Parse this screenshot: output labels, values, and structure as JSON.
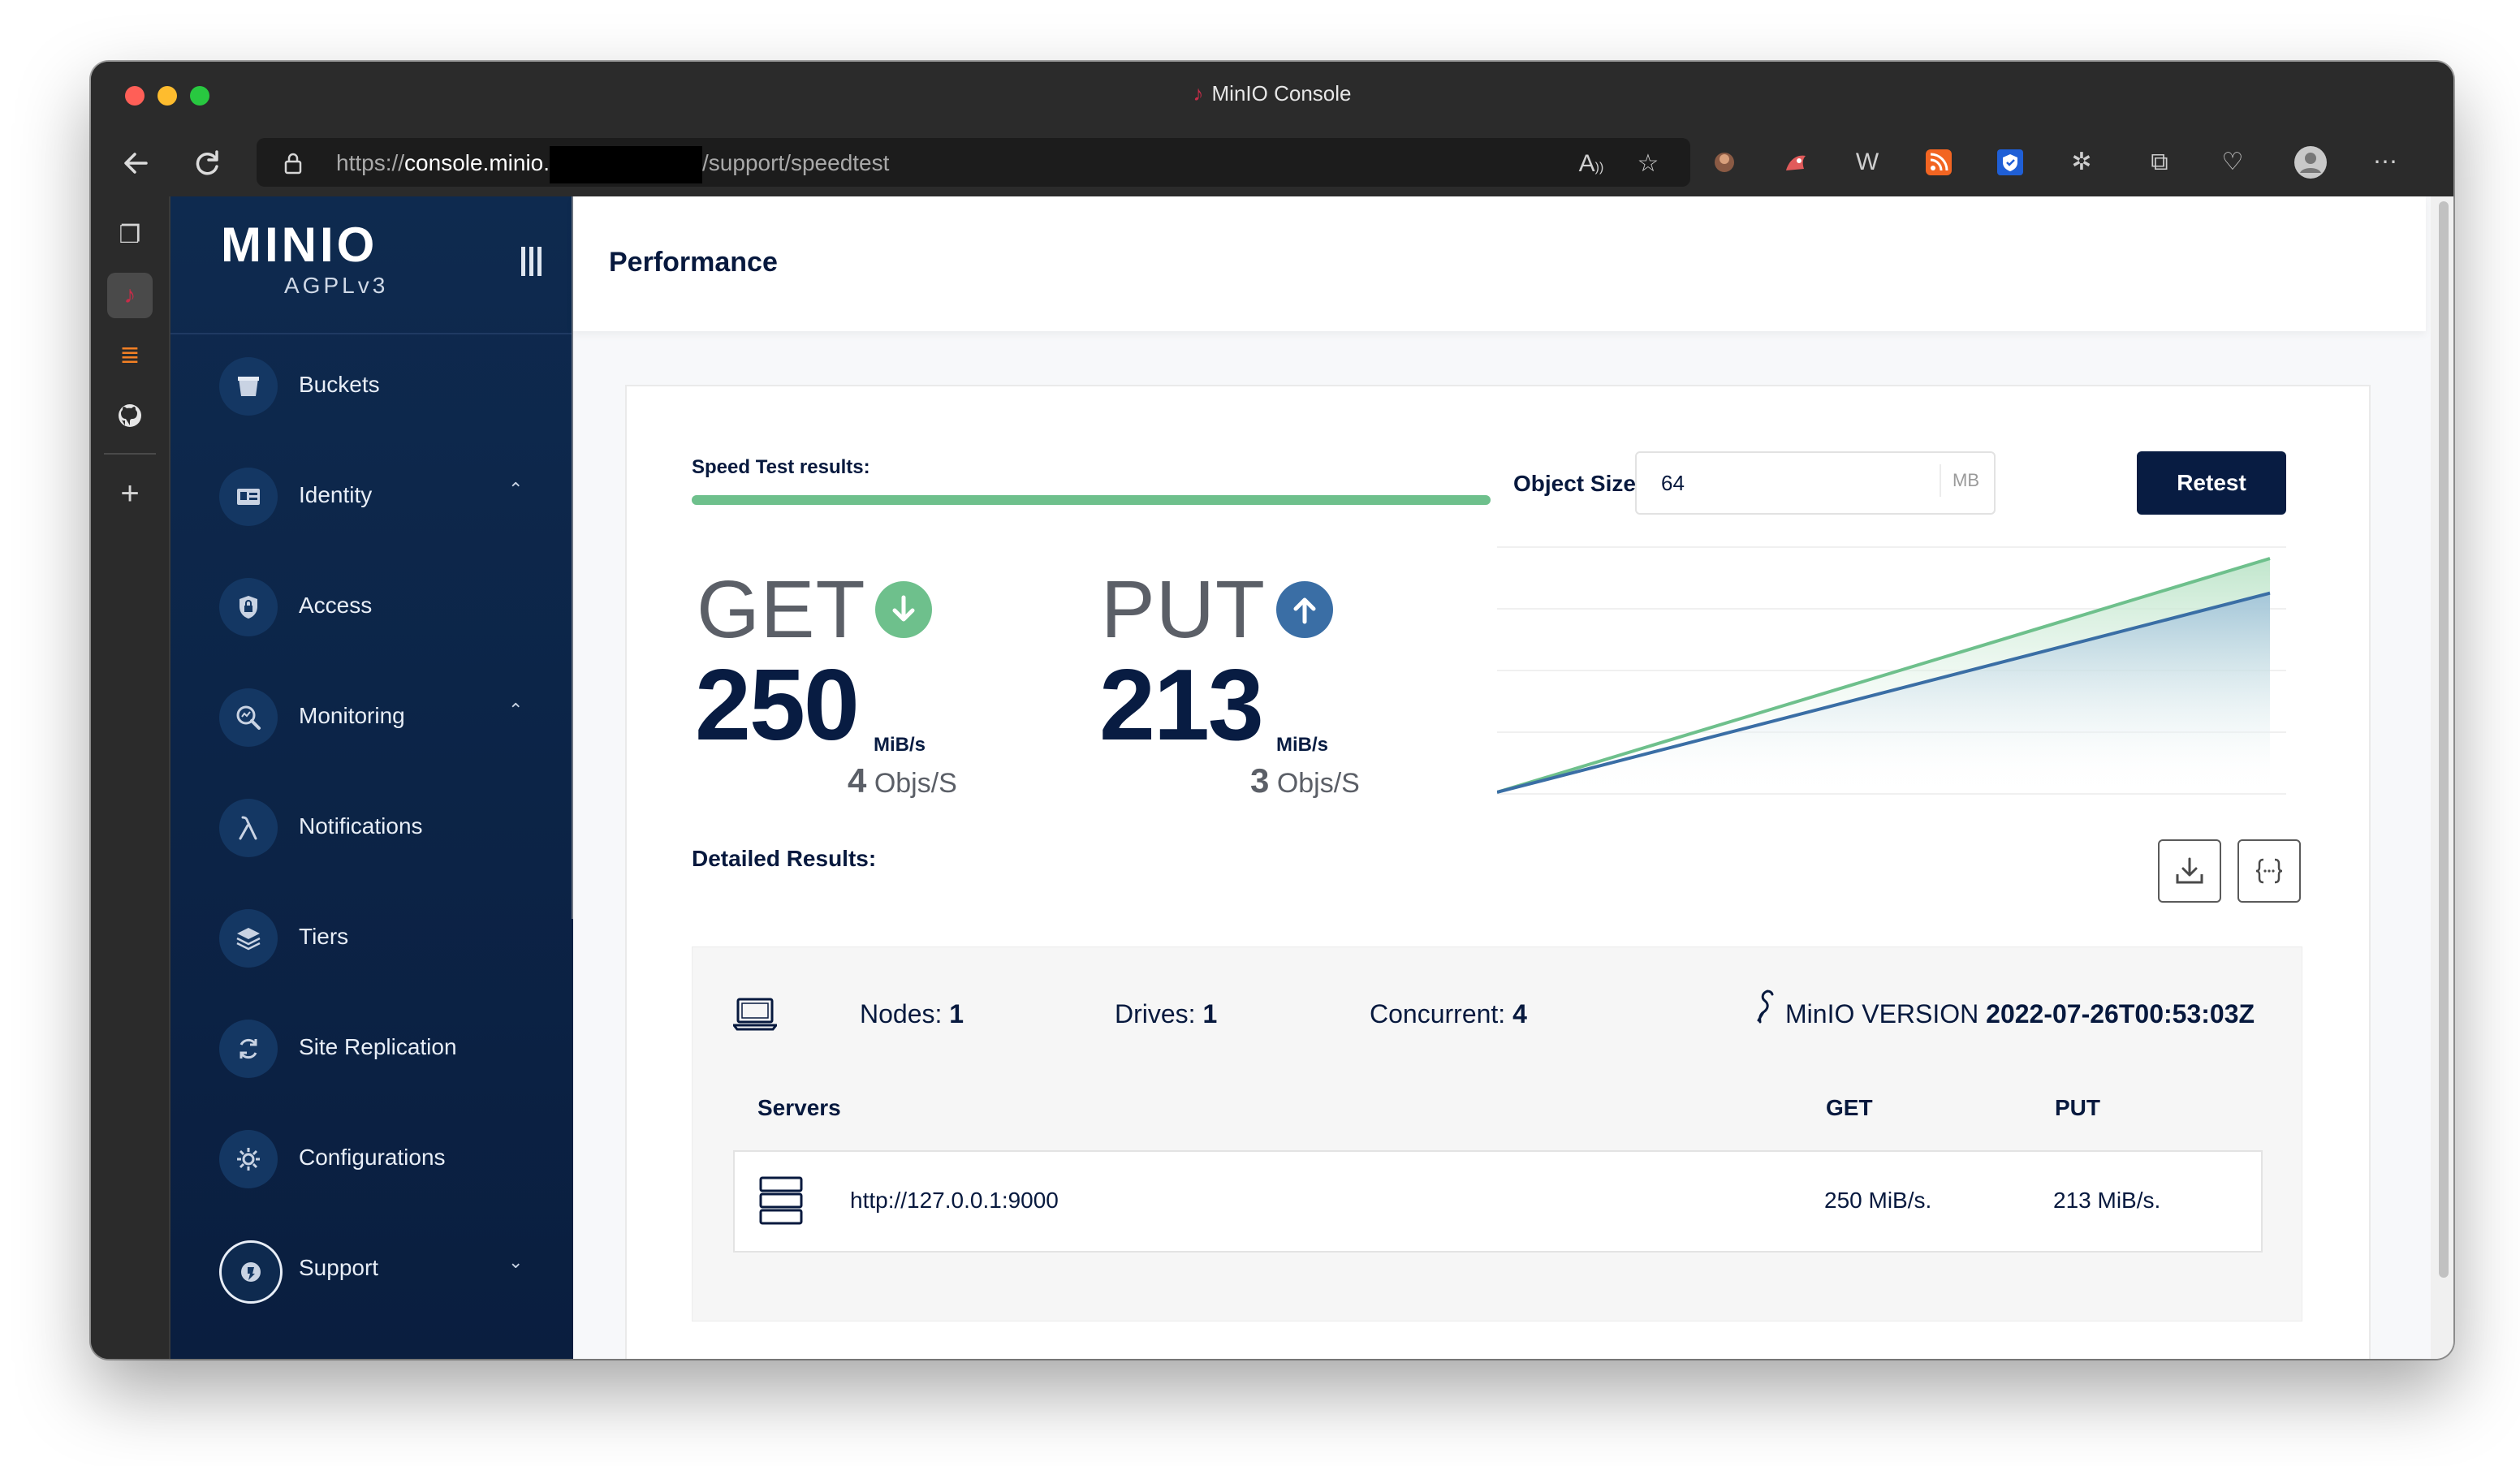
{
  "browser": {
    "window_title": "MinIO Console",
    "url_prefix": "https://",
    "url_host": "console.minio.",
    "url_path": "/support/speedtest"
  },
  "sidebar": {
    "edition": "AGPLv3",
    "items": [
      {
        "label": "Buckets",
        "icon": "bucket-icon"
      },
      {
        "label": "Identity",
        "icon": "id-card-icon",
        "expanded": true
      },
      {
        "label": "Access",
        "icon": "lock-icon"
      },
      {
        "label": "Monitoring",
        "icon": "magnifier-chart-icon",
        "expanded": true
      },
      {
        "label": "Notifications",
        "icon": "lambda-icon"
      },
      {
        "label": "Tiers",
        "icon": "layers-icon"
      },
      {
        "label": "Site Replication",
        "icon": "sync-icon"
      },
      {
        "label": "Configurations",
        "icon": "gear-icon"
      },
      {
        "label": "Support",
        "icon": "support-icon",
        "expanded": false
      }
    ]
  },
  "page": {
    "title": "Performance"
  },
  "speedtest": {
    "results_label": "Speed Test results:",
    "progress": 1.0,
    "object_size_label": "Object Size",
    "object_size_value": "64",
    "object_size_unit": "MB",
    "retest_label": "Retest",
    "get": {
      "label": "GET",
      "value": "250",
      "unit": "MiB/s",
      "objs_value": "4",
      "objs_unit": "Objs/S"
    },
    "put": {
      "label": "PUT",
      "value": "213",
      "unit": "MiB/s",
      "objs_value": "3",
      "objs_unit": "Objs/S"
    },
    "colors": {
      "get": "#6ec08c",
      "put": "#3a6ea5",
      "navy": "#081c42"
    }
  },
  "chart_data": {
    "type": "area",
    "title": "",
    "xlabel": "",
    "ylabel": "",
    "series": [
      {
        "values": [
          0,
          250
        ]
      },
      {
        "values": [
          0,
          213
        ]
      }
    ]
  },
  "details": {
    "label": "Detailed Results:",
    "nodes_label": "Nodes:",
    "nodes": "1",
    "drives_label": "Drives:",
    "drives": "1",
    "concurrent_label": "Concurrent:",
    "concurrent": "4",
    "version_label": "MinIO VERSION",
    "version": "2022-07-26T00:53:03Z",
    "columns": [
      "Servers",
      "GET",
      "PUT"
    ],
    "rows": [
      {
        "server": "http://127.0.0.1:9000",
        "get": "250 MiB/s.",
        "put": "213 MiB/s."
      }
    ]
  }
}
